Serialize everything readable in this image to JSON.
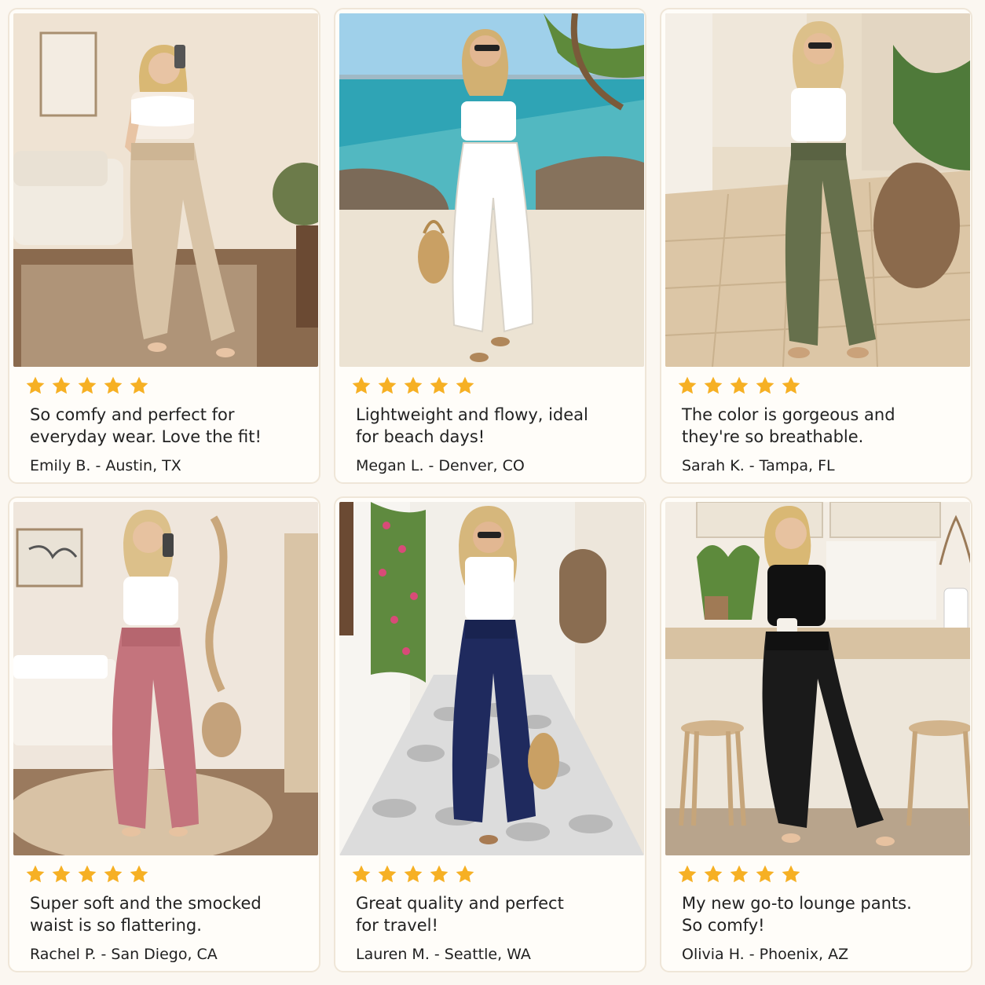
{
  "reviews": [
    {
      "rating": 5,
      "quote": "So comfy and perfect for\neveryday wear. Love the fit!",
      "author": "Emily B. - Austin, TX",
      "pant_color": "#d8c3a6",
      "top_color": "#ffffff",
      "setting": "living room"
    },
    {
      "rating": 5,
      "quote": "Lightweight and flowy, ideal\nfor beach days!",
      "author": "Megan L. - Denver, CO",
      "pant_color": "#ffffff",
      "top_color": "#ffffff",
      "setting": "beach"
    },
    {
      "rating": 5,
      "quote": "The color is gorgeous and\nthey're so breathable.",
      "author": "Sarah K. - Tampa, FL",
      "pant_color": "#66704c",
      "top_color": "#ffffff",
      "setting": "patio"
    },
    {
      "rating": 5,
      "quote": "Super soft and the smocked\nwaist is so flattering.",
      "author": "Rachel P. - San Diego, CA",
      "pant_color": "#c4747d",
      "top_color": "#ffffff",
      "setting": "bedroom"
    },
    {
      "rating": 5,
      "quote": "Great quality and perfect\nfor travel!",
      "author": "Lauren M. - Seattle, WA",
      "pant_color": "#1f2a5e",
      "top_color": "#ffffff",
      "setting": "alley"
    },
    {
      "rating": 5,
      "quote": "My new go-to lounge pants.\nSo comfy!",
      "author": "Olivia H. - Phoenix, AZ",
      "pant_color": "#1a1a1a",
      "top_color": "#111111",
      "setting": "kitchen"
    }
  ],
  "star_color": "#f6b024",
  "icons": {
    "star": "star-icon"
  }
}
